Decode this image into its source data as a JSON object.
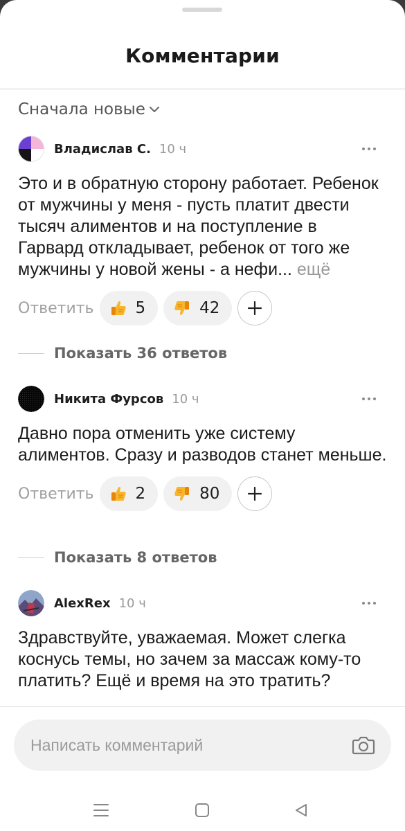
{
  "header": {
    "title": "Комментарии"
  },
  "sort": {
    "label": "Сначала новые"
  },
  "comments": [
    {
      "author": "Владислав С.",
      "time": "10 ч",
      "text": "Это и в обратную сторону работает. Ребенок от мужчины у меня - пусть платит двести тысяч алиментов и на поступление в Гарвард откладывает, ребенок от того же мужчины у новой жены - а нефи...",
      "more_label": "ещё",
      "reply_label": "Ответить",
      "likes": "5",
      "dislikes": "42",
      "show_replies": "Показать 36 ответов"
    },
    {
      "author": "Никита Фурсов",
      "time": "10 ч",
      "text": "Давно пора отменить уже систему алиментов. Сразу и разводов станет меньше.",
      "reply_label": "Ответить",
      "likes": "2",
      "dislikes": "80",
      "show_replies": "Показать 8 ответов"
    },
    {
      "author": "AlexRex",
      "time": "10 ч",
      "text": "Здравствуйте, уважаемая. Может слегка коснусь темы, но зачем за массаж кому-то платить? Ещё и время на это тратить?"
    }
  ],
  "composer": {
    "placeholder": "Написать комментарий"
  },
  "icons": {
    "like": "thumbs-up-icon",
    "dislike": "thumbs-down-icon",
    "add_reaction": "plus-icon",
    "more": "more-dots-icon",
    "camera": "camera-icon",
    "nav_menu": "menu-icon",
    "nav_home": "home-square-icon",
    "nav_back": "back-triangle-icon"
  },
  "colors": {
    "reaction_bg": "#f1f1f1",
    "accent_emoji": "#f5a623"
  }
}
